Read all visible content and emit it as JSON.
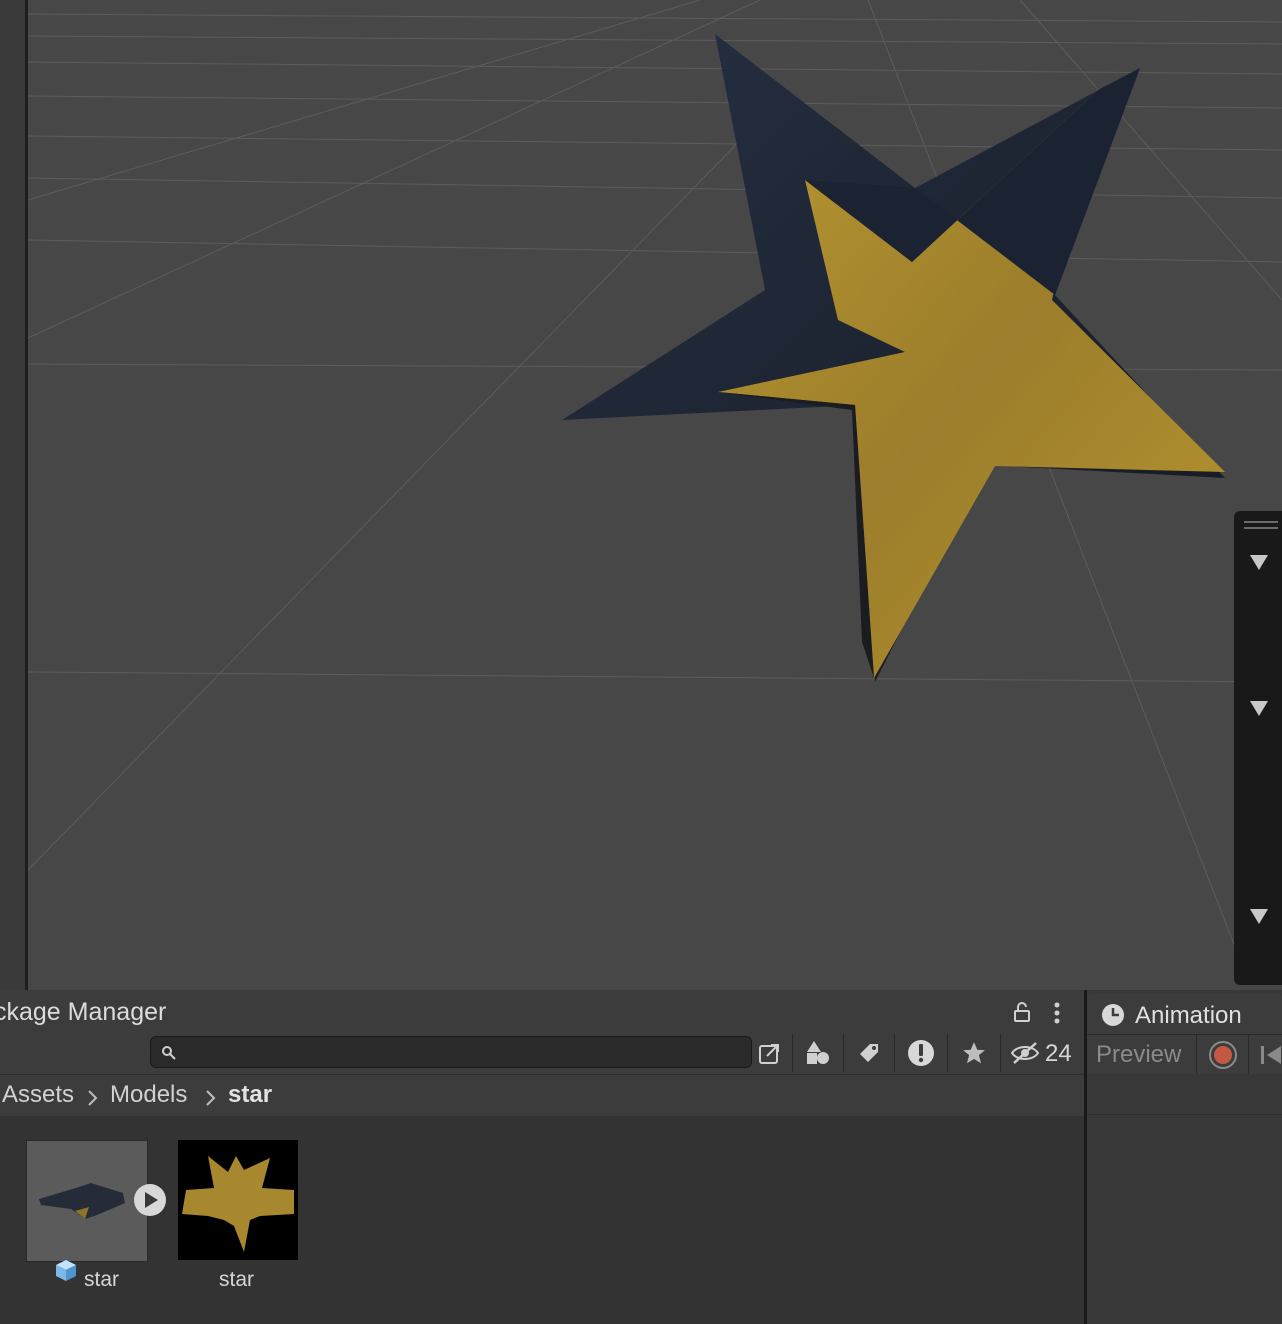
{
  "scene": {
    "overlay_panel": {
      "sections": 3
    }
  },
  "project": {
    "tab_title": "ckage Manager",
    "search": {
      "value": "",
      "placeholder": ""
    },
    "hidden_count": "24",
    "breadcrumb": [
      "Assets",
      "Models",
      "star"
    ],
    "assets": [
      {
        "label": "star",
        "type": "model"
      },
      {
        "label": "star",
        "type": "texture"
      }
    ]
  },
  "animation": {
    "tab_title": "Animation",
    "preview_label": "Preview"
  },
  "colors": {
    "star_gold": "#a8882e",
    "star_dark": "#1c2331",
    "scene_bg": "#474747",
    "panel_bg": "#383838",
    "record_red": "#c25a43"
  }
}
